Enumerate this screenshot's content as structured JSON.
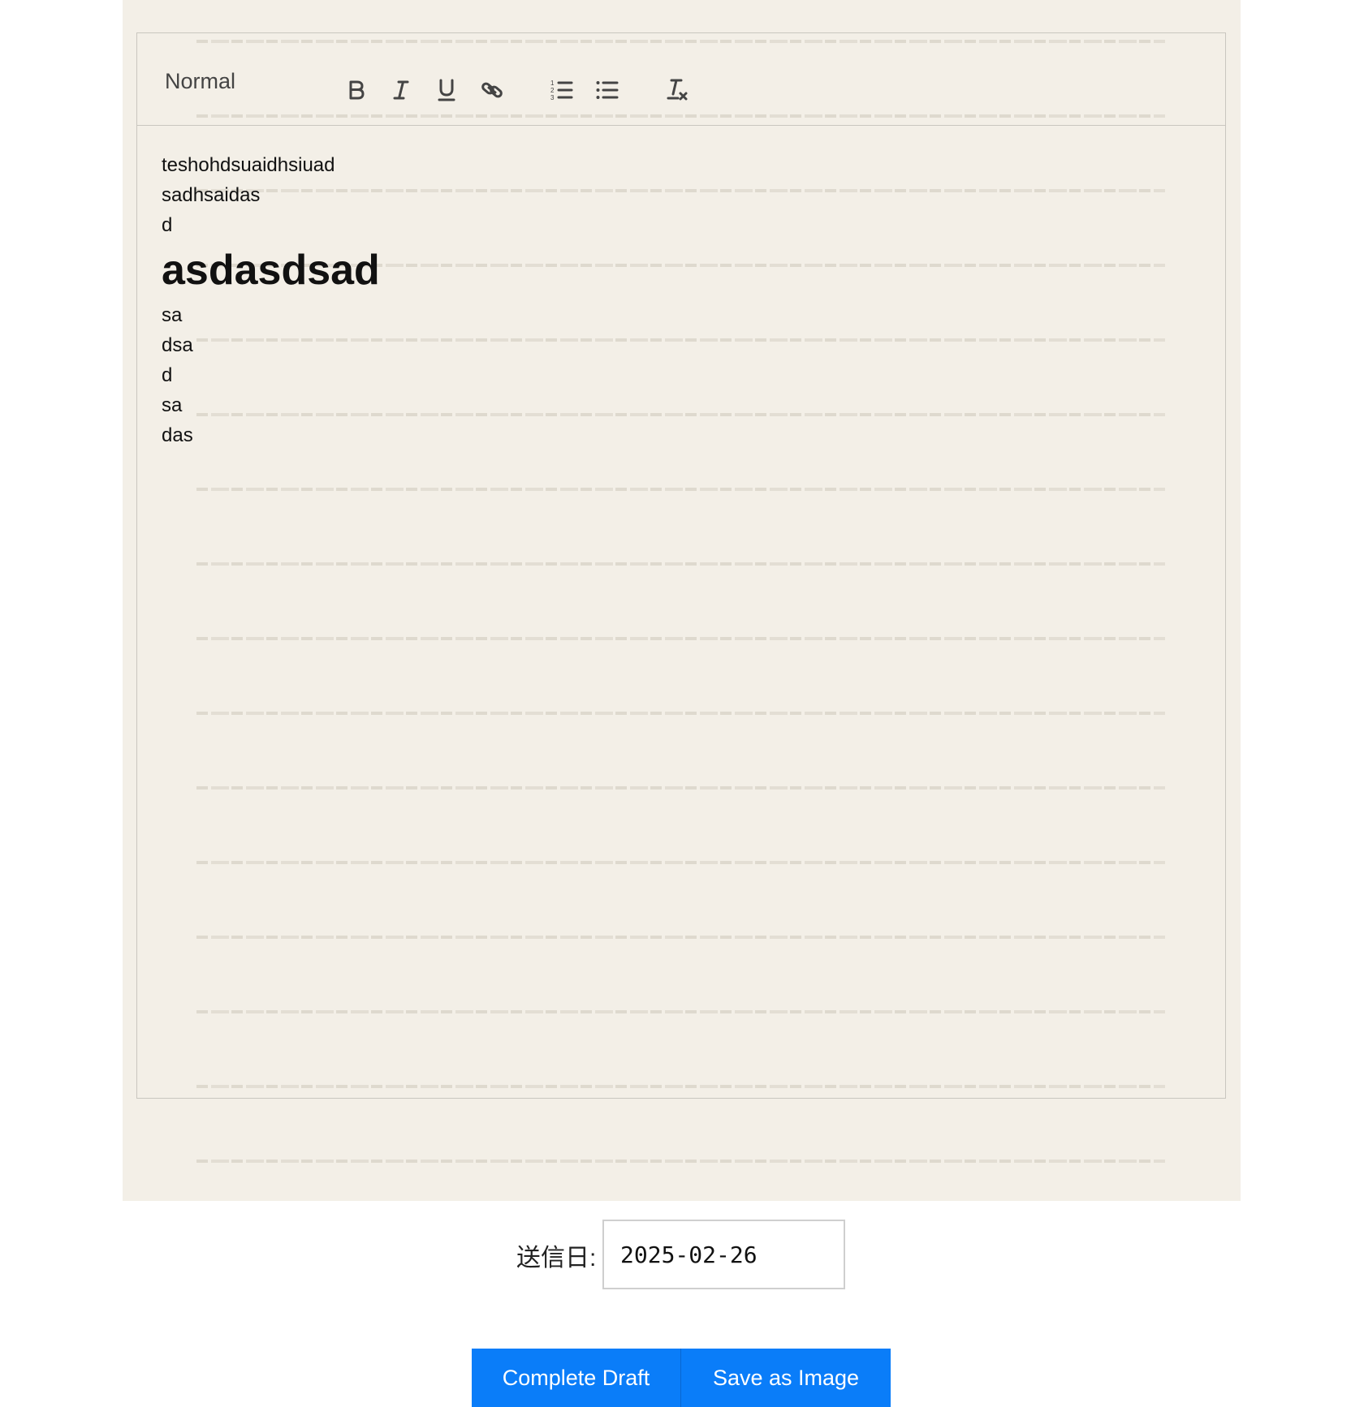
{
  "toolbar": {
    "format_select": "Normal",
    "buttons": [
      {
        "name": "bold",
        "icon": "bold-icon"
      },
      {
        "name": "italic",
        "icon": "italic-icon"
      },
      {
        "name": "underline",
        "icon": "underline-icon"
      },
      {
        "name": "link",
        "icon": "link-icon"
      },
      {
        "name": "ordered-list",
        "icon": "ordered-list-icon"
      },
      {
        "name": "bullet-list",
        "icon": "bullet-list-icon"
      },
      {
        "name": "clear-format",
        "icon": "clear-format-icon"
      }
    ]
  },
  "editor": {
    "lines": [
      "teshohdsuaidhsiuad",
      "sadhsaidas",
      "d"
    ],
    "heading": "asdasdsad",
    "lines_after": [
      "sa",
      "dsa",
      "d",
      "sa",
      "das"
    ]
  },
  "date": {
    "label": "送信日:",
    "value": "2025-02-26"
  },
  "actions": {
    "complete_label": "Complete Draft",
    "save_label": "Save as Image"
  },
  "colors": {
    "paper": "#f3efe7",
    "primary_button": "#0a7df9",
    "border": "#c9c6bf"
  }
}
